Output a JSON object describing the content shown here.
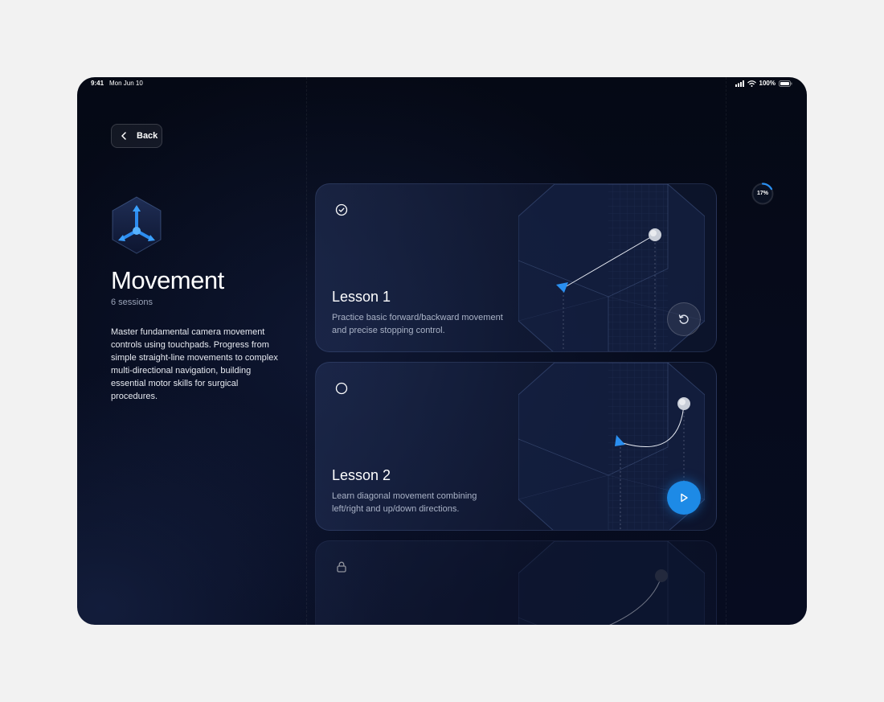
{
  "status_bar": {
    "time": "9:41",
    "date": "Mon Jun 10",
    "battery": "100%"
  },
  "back_button": {
    "label": "Back"
  },
  "module": {
    "title": "Movement",
    "sessions": "6 sessions",
    "description": "Master fundamental camera movement controls using touchpads. Progress from simple straight-line movements to complex multi-directional navigation, building essential motor skills for surgical procedures."
  },
  "progress": {
    "label": "17%",
    "value": 0.17,
    "color": "#2a8ff0"
  },
  "lessons": [
    {
      "title": "Lesson 1",
      "description": "Practice basic forward/backward movement and precise stopping control.",
      "status": "completed",
      "status_icon": "check-circle-icon",
      "action_icon": "replay-icon"
    },
    {
      "title": "Lesson 2",
      "description": "Learn diagonal movement combining left/right and up/down directions.",
      "status": "available",
      "status_icon": "circle-icon",
      "action_icon": "play-icon"
    },
    {
      "title": "",
      "description": "",
      "status": "locked",
      "status_icon": "lock-icon"
    }
  ],
  "colors": {
    "accent": "#1d8ae6",
    "background": "#050915"
  }
}
